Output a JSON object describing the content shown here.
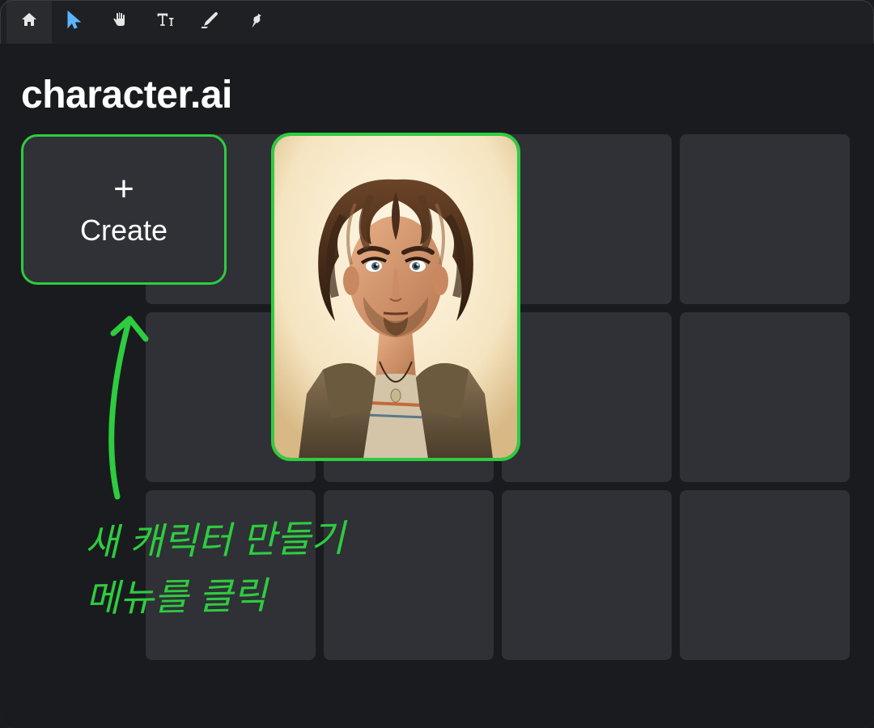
{
  "app": {
    "title": "character.ai"
  },
  "toolbar": {
    "tools": {
      "home": "home-icon",
      "pointer": "pointer-icon",
      "hand": "hand-icon",
      "text": "text-icon",
      "draw": "draw-icon",
      "pin": "pin-icon"
    },
    "active_tool": "pointer"
  },
  "create_button": {
    "plus": "+",
    "label": "Create"
  },
  "annotation": {
    "line1": "새 캐릭터 만들기",
    "line2": "메뉴를 클릭"
  },
  "colors": {
    "highlight": "#2ecc40",
    "tool_active": "#5bb4ff",
    "bg": "#1a1b1e",
    "panel": "#2f3136"
  }
}
